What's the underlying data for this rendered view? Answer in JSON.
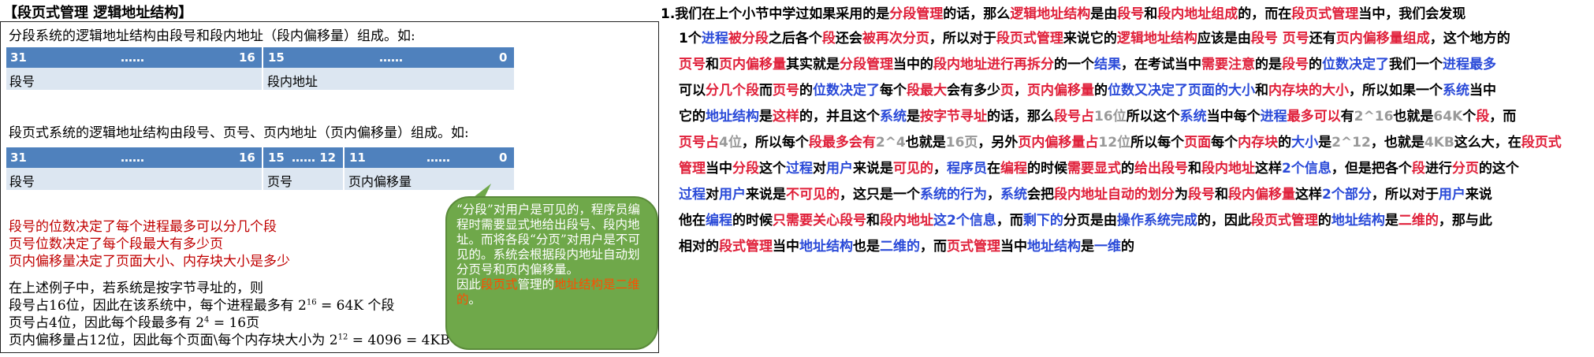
{
  "slide": {
    "title": "【段页式管理 逻辑地址结构】",
    "seg_intro": "分段系统的逻辑地址结构由段号和段内地址（段内偏移量）组成。如:",
    "seg_bar": {
      "b31": "31",
      "dots1": "……",
      "b16": "16",
      "b15": "15",
      "dots2": "……",
      "b0": "0"
    },
    "seg_labels": {
      "seg_no": "段号",
      "seg_addr": "段内地址"
    },
    "pageseg_intro": "段页式系统的逻辑地址结构由段号、页号、页内地址（页内偏移量）组成。如:",
    "ps_bar": {
      "b31": "31",
      "dots1": "……",
      "b16": "16",
      "b15": "15",
      "dots2": "…… 12",
      "b11": "11",
      "dots3": "……",
      "b0": "0"
    },
    "ps_labels": {
      "seg_no": "段号",
      "page_no": "页号",
      "page_off": "页内偏移量"
    },
    "red_lines": [
      "段号的位数决定了每个进程最多可以分几个段",
      "页号位数决定了每个段最大有多少页",
      "页内偏移量决定了页面大小、内存块大小是多少"
    ],
    "example": {
      "l1": "在上述例子中，若系统是按字节寻址的，则",
      "l2a": "段号占16位，因此在该系统中，每个进程最多有 2",
      "l2exp": "16",
      "l2b": " = 64K 个段",
      "l3a": "页号占4位，因此每个段最多有 2",
      "l3exp": "4",
      "l3b": " = 16页",
      "l4a": "页内偏移量占12位，因此每个页面\\每个内存块大小为 2",
      "l4exp": "12",
      "l4b": " = 4096 = 4KB"
    },
    "bubble": {
      "t1": "“分段”对用户是可见的，程序员编程时需要显式地给出段号、段内地址。而将各段“分页”对用户是不可见的。系统会根据段内地址自动划分页号和页内偏移量。",
      "t2a": "因此",
      "t2b": "段页式",
      "t2c": "管理的",
      "t2d": "地址结构是二维的",
      "t2e": "。"
    }
  },
  "notes": {
    "lines": [
      [
        [
          "1.我们在上个小节中学过如果采用的是",
          "n"
        ],
        [
          "分段管理",
          "r"
        ],
        [
          "的话，那么",
          "n"
        ],
        [
          "逻辑地址结构",
          "r"
        ],
        [
          "是由",
          "n"
        ],
        [
          "段号",
          "r"
        ],
        [
          "和",
          "n"
        ],
        [
          "段内地址组成",
          "r"
        ],
        [
          "的，而在",
          "n"
        ],
        [
          "段页式管理",
          "r"
        ],
        [
          "当中，我们会发现",
          "n"
        ]
      ],
      [
        [
          "1个",
          "n"
        ],
        [
          "进程",
          "b"
        ],
        [
          "被分段",
          "r"
        ],
        [
          "之后各个",
          "n"
        ],
        [
          "段",
          "r"
        ],
        [
          "还会",
          "n"
        ],
        [
          "被再次分页",
          "r"
        ],
        [
          "，所以对于",
          "n"
        ],
        [
          "段页式管理",
          "r"
        ],
        [
          "来说它的",
          "n"
        ],
        [
          "逻辑地址结构",
          "r"
        ],
        [
          "应该是由",
          "n"
        ],
        [
          "段号 页号",
          "r"
        ],
        [
          "还有",
          "n"
        ],
        [
          "页内偏移量组成",
          "r"
        ],
        [
          "，这个地方的",
          "n"
        ]
      ],
      [
        [
          "页号",
          "r"
        ],
        [
          "和",
          "n"
        ],
        [
          "页内偏移量",
          "r"
        ],
        [
          "其实就是",
          "n"
        ],
        [
          "分段管理",
          "r"
        ],
        [
          "当中的",
          "n"
        ],
        [
          "段内地址进行再拆分",
          "r"
        ],
        [
          "的一个",
          "n"
        ],
        [
          "结果",
          "b"
        ],
        [
          "，在考试当中",
          "n"
        ],
        [
          "需要注意",
          "r"
        ],
        [
          "的是",
          "n"
        ],
        [
          "段号",
          "r"
        ],
        [
          "的",
          "n"
        ],
        [
          "位数决定了",
          "b"
        ],
        [
          "我们一个",
          "n"
        ],
        [
          "进程最多",
          "b"
        ]
      ],
      [
        [
          "可以",
          "n"
        ],
        [
          "分几个段",
          "r"
        ],
        [
          "而",
          "n"
        ],
        [
          "页号",
          "r"
        ],
        [
          "的",
          "n"
        ],
        [
          "位数决定了",
          "b"
        ],
        [
          "每个",
          "n"
        ],
        [
          "段最大",
          "r"
        ],
        [
          "会有多少",
          "n"
        ],
        [
          "页",
          "r"
        ],
        [
          "，",
          "n"
        ],
        [
          "页内偏移量",
          "r"
        ],
        [
          "的",
          "n"
        ],
        [
          "位数又决定了页面的大小",
          "b"
        ],
        [
          "和",
          "n"
        ],
        [
          "内存块的大小",
          "r"
        ],
        [
          "，所以如果一个",
          "n"
        ],
        [
          "系统",
          "b"
        ],
        [
          "当中",
          "n"
        ]
      ],
      [
        [
          "它的",
          "n"
        ],
        [
          "地址结构",
          "b"
        ],
        [
          "是",
          "n"
        ],
        [
          "这样",
          "r"
        ],
        [
          "的，并且这个",
          "n"
        ],
        [
          "系统",
          "b"
        ],
        [
          "是",
          "n"
        ],
        [
          "按字节寻址",
          "r"
        ],
        [
          "的话，那么",
          "n"
        ],
        [
          "段号占",
          "r"
        ],
        [
          "16位",
          "g"
        ],
        [
          "所以这个",
          "n"
        ],
        [
          "系统",
          "b"
        ],
        [
          "当中每个",
          "n"
        ],
        [
          "进程",
          "b"
        ],
        [
          "最多可以",
          "r"
        ],
        [
          "有",
          "n"
        ],
        [
          "2^16",
          "g"
        ],
        [
          "也就是",
          "n"
        ],
        [
          "64K",
          "g"
        ],
        [
          "个",
          "n"
        ],
        [
          "段",
          "r"
        ],
        [
          "，而",
          "n"
        ]
      ],
      [
        [
          "页号占",
          "r"
        ],
        [
          "4位",
          "g"
        ],
        [
          "，所以每个",
          "n"
        ],
        [
          "段最多会有",
          "r"
        ],
        [
          "2^4",
          "g"
        ],
        [
          "也就是",
          "n"
        ],
        [
          "16页",
          "g"
        ],
        [
          "，另外",
          "n"
        ],
        [
          "页内偏移量占",
          "r"
        ],
        [
          "12位",
          "g"
        ],
        [
          "所以每个",
          "n"
        ],
        [
          "页面",
          "r"
        ],
        [
          "每个",
          "n"
        ],
        [
          "内存块",
          "r"
        ],
        [
          "的",
          "n"
        ],
        [
          "大小",
          "b"
        ],
        [
          "是",
          "n"
        ],
        [
          "2^12",
          "g"
        ],
        [
          "，也就是",
          "n"
        ],
        [
          "4KB",
          "g"
        ],
        [
          "这么大，在",
          "n"
        ],
        [
          "段页式",
          "r"
        ]
      ],
      [
        [
          "管理",
          "r"
        ],
        [
          "当中",
          "n"
        ],
        [
          "分段",
          "r"
        ],
        [
          "这个",
          "n"
        ],
        [
          "过程",
          "b"
        ],
        [
          "对",
          "n"
        ],
        [
          "用户",
          "b"
        ],
        [
          "来说是",
          "n"
        ],
        [
          "可见的",
          "r"
        ],
        [
          "，",
          "n"
        ],
        [
          "程序员",
          "b"
        ],
        [
          "在",
          "n"
        ],
        [
          "编程",
          "r"
        ],
        [
          "的时候",
          "n"
        ],
        [
          "需要显式",
          "r"
        ],
        [
          "的",
          "n"
        ],
        [
          "给出段号",
          "r"
        ],
        [
          "和",
          "n"
        ],
        [
          "段内地址",
          "r"
        ],
        [
          "这样",
          "n"
        ],
        [
          "2个信息",
          "b"
        ],
        [
          "，但是把各个",
          "n"
        ],
        [
          "段",
          "r"
        ],
        [
          "进行",
          "n"
        ],
        [
          "分页",
          "r"
        ],
        [
          "的这个",
          "n"
        ]
      ],
      [
        [
          "过程",
          "b"
        ],
        [
          "对",
          "n"
        ],
        [
          "用户",
          "b"
        ],
        [
          "来说是",
          "n"
        ],
        [
          "不可见的",
          "r"
        ],
        [
          "，这只是一个",
          "n"
        ],
        [
          "系统的行为",
          "b"
        ],
        [
          "，",
          "n"
        ],
        [
          "系统",
          "b"
        ],
        [
          "会把",
          "n"
        ],
        [
          "段内地址自动的划分",
          "r"
        ],
        [
          "为",
          "n"
        ],
        [
          "段号",
          "r"
        ],
        [
          "和",
          "n"
        ],
        [
          "段内偏移量",
          "r"
        ],
        [
          "这样",
          "n"
        ],
        [
          "2个部分",
          "b"
        ],
        [
          "，所以对于",
          "n"
        ],
        [
          "用户",
          "b"
        ],
        [
          "来说",
          "n"
        ]
      ],
      [
        [
          "他在",
          "n"
        ],
        [
          "编程",
          "b"
        ],
        [
          "的时候",
          "n"
        ],
        [
          "只需要关心段号",
          "r"
        ],
        [
          "和",
          "n"
        ],
        [
          "段内地址",
          "r"
        ],
        [
          "这2个信息",
          "b"
        ],
        [
          "，而",
          "n"
        ],
        [
          "剩下的",
          "b"
        ],
        [
          "分页是由",
          "n"
        ],
        [
          "操作系统完成",
          "b"
        ],
        [
          "的，因此",
          "n"
        ],
        [
          "段页式管理",
          "r"
        ],
        [
          "的",
          "n"
        ],
        [
          "地址结构",
          "b"
        ],
        [
          "是",
          "n"
        ],
        [
          "二维的",
          "r"
        ],
        [
          "，那与此",
          "n"
        ]
      ],
      [
        [
          "相对的",
          "n"
        ],
        [
          "段式管理",
          "r"
        ],
        [
          "当中",
          "n"
        ],
        [
          "地址结构",
          "b"
        ],
        [
          "也是",
          "n"
        ],
        [
          "二维的",
          "b"
        ],
        [
          "，而",
          "n"
        ],
        [
          "页式管理",
          "r"
        ],
        [
          "当中",
          "n"
        ],
        [
          "地址结构",
          "b"
        ],
        [
          "是",
          "n"
        ],
        [
          "一维",
          "b"
        ],
        [
          "的",
          "n"
        ]
      ]
    ]
  }
}
